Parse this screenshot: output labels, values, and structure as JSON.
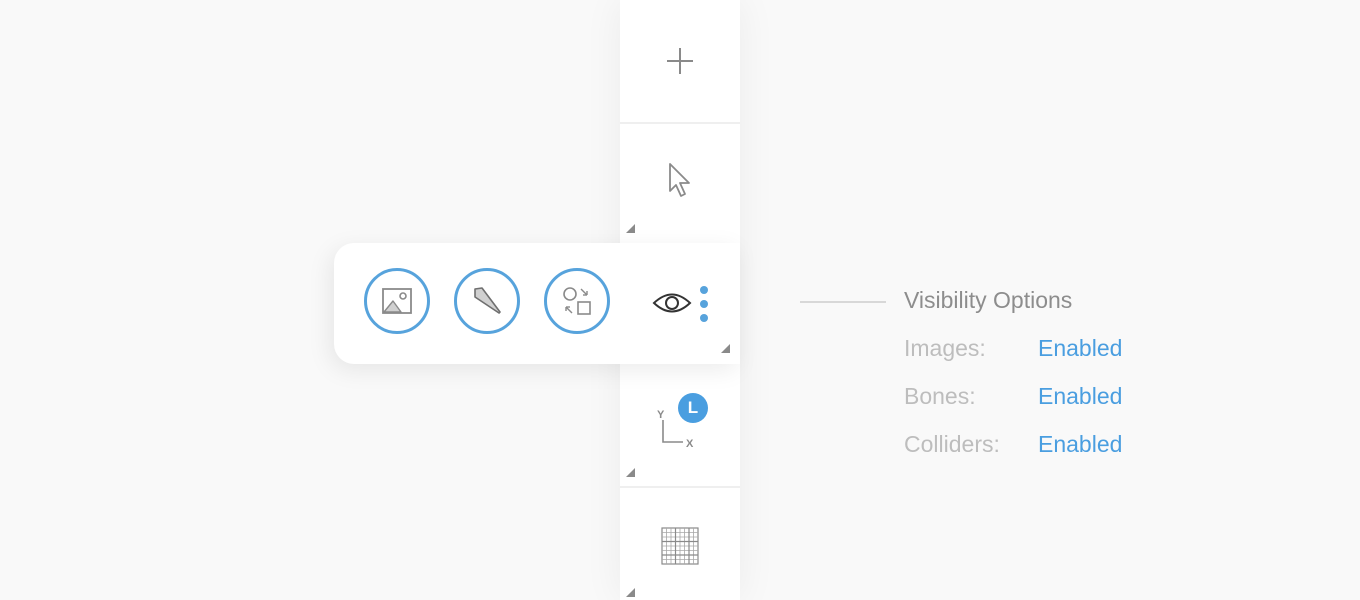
{
  "toolbar": {
    "tools": [
      {
        "name": "add",
        "icon": "plus-icon"
      },
      {
        "name": "select",
        "icon": "cursor-arrow-icon"
      },
      {
        "name": "visibility",
        "icon": "eye-icon"
      },
      {
        "name": "axes",
        "icon": "axes-icon",
        "badge": "L",
        "axis_y": "Y",
        "axis_x": "X"
      },
      {
        "name": "grid",
        "icon": "grid-icon"
      }
    ]
  },
  "popout": {
    "buttons": [
      {
        "name": "images-toggle",
        "icon": "image-icon"
      },
      {
        "name": "bones-toggle",
        "icon": "bone-icon"
      },
      {
        "name": "colliders-toggle",
        "icon": "collider-icon"
      }
    ],
    "eye_icon": "eye-icon",
    "more_icon": "more-vertical-icon"
  },
  "visibility_panel": {
    "title": "Visibility Options",
    "options": [
      {
        "label": "Images:",
        "value": "Enabled"
      },
      {
        "label": "Bones:",
        "value": "Enabled"
      },
      {
        "label": "Colliders:",
        "value": "Enabled"
      }
    ]
  },
  "colors": {
    "accent": "#57a3dc",
    "badge": "#4a9ee0",
    "icon_gray": "#8a8a8a",
    "label_gray": "#bdbdbd",
    "title_gray": "#8d8d8d"
  }
}
